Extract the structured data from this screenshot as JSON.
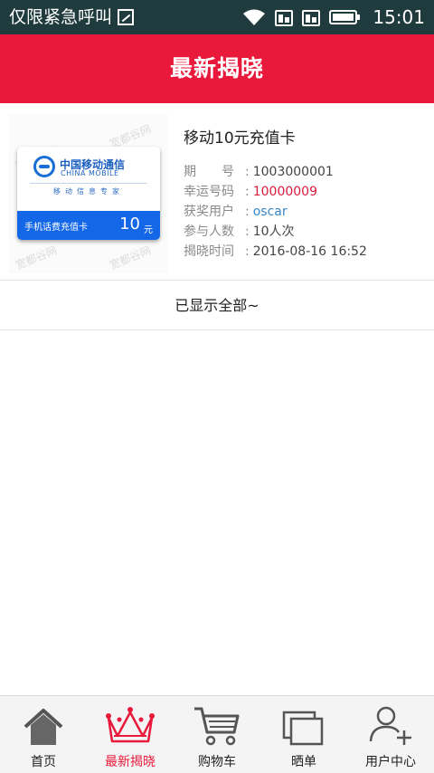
{
  "status_bar": {
    "carrier_text": "仅限紧急呼叫",
    "time": "15:01",
    "icons": [
      "sim-icon",
      "wifi-icon",
      "signal-icon",
      "signal-icon",
      "battery-icon"
    ]
  },
  "header": {
    "title": "最新揭晓"
  },
  "item": {
    "title": "移动10元充值卡",
    "image": {
      "card_name_cn": "中国移动通信",
      "card_name_en": "CHINA MOBILE",
      "card_slogan": "移动信息专家",
      "card_band_label": "手机话费充值卡",
      "card_band_value": "10",
      "card_band_unit": "元",
      "watermark": "宽都谷网"
    },
    "meta": [
      {
        "label": "期　　号",
        "value": "1003000001",
        "color": "#444444"
      },
      {
        "label": "幸运号码",
        "value": "10000009",
        "color": "#d91a3b"
      },
      {
        "label": "获奖用户",
        "value": "oscar",
        "color": "#3a87c8"
      },
      {
        "label": "参与人数",
        "value": "10人次",
        "color": "#444444"
      },
      {
        "label": "揭晓时间",
        "value": "2016-08-16 16:52",
        "color": "#444444"
      }
    ]
  },
  "list_footer": {
    "text": "已显示全部~"
  },
  "tabbar": {
    "tabs": [
      {
        "label": "首页",
        "icon": "home-icon",
        "active": false
      },
      {
        "label": "最新揭晓",
        "icon": "crown-icon",
        "active": true
      },
      {
        "label": "购物车",
        "icon": "cart-icon",
        "active": false
      },
      {
        "label": "晒单",
        "icon": "share-order-icon",
        "active": false
      },
      {
        "label": "用户中心",
        "icon": "user-add-icon",
        "active": false
      }
    ]
  },
  "colors": {
    "brand_red": "#e8193a",
    "status_bar": "#1f3b3d",
    "link_blue": "#3a87c8"
  }
}
